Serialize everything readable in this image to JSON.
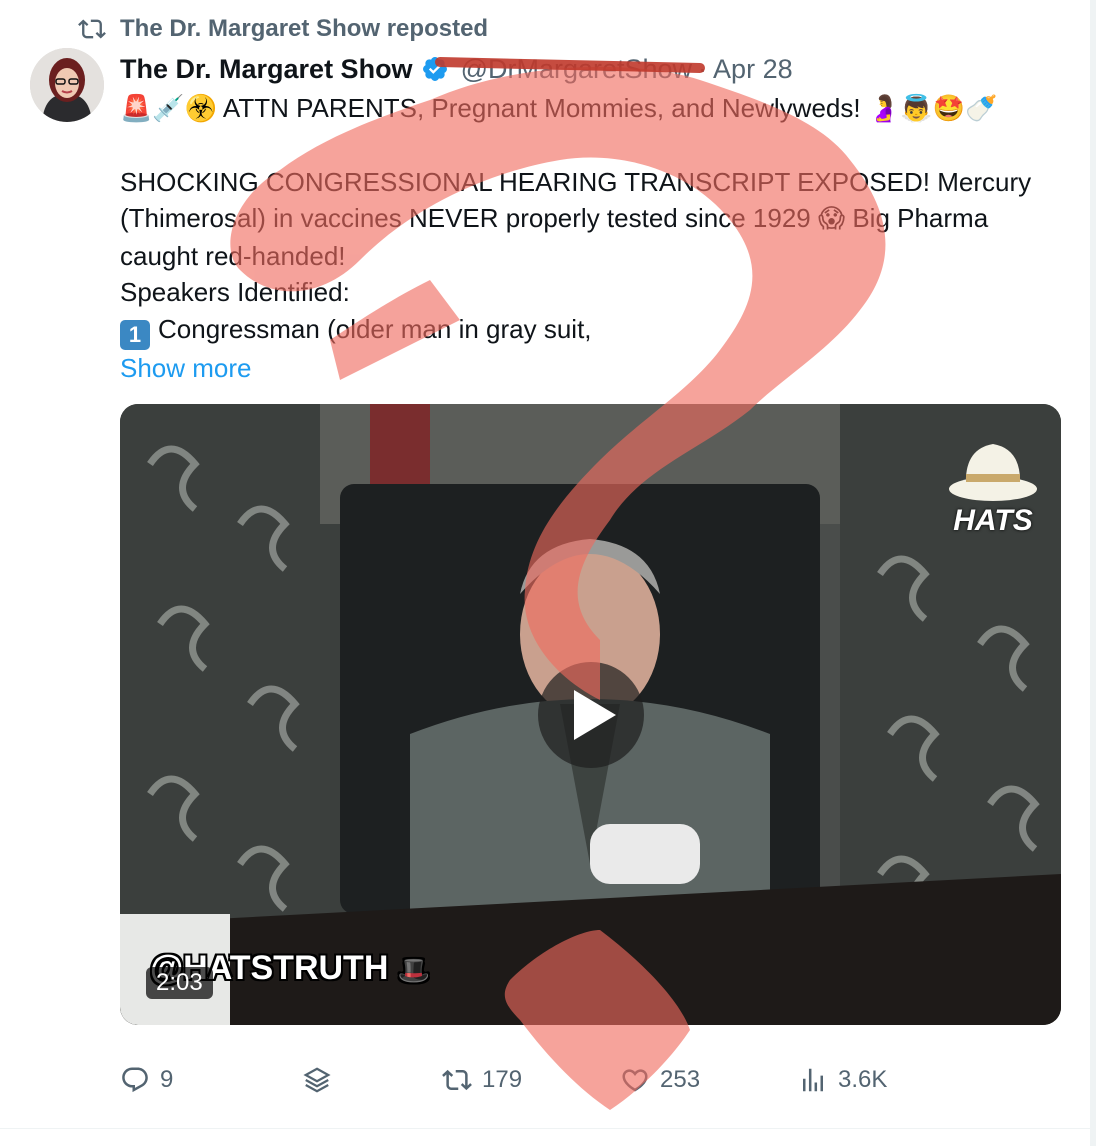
{
  "repost": {
    "text": "The Dr. Margaret Show reposted",
    "icon": "repost-icon"
  },
  "author": {
    "name": "The Dr. Margaret Show",
    "handle": "@DrMargaretShow",
    "date": "Apr 28",
    "separator": "·",
    "verified": true
  },
  "post": {
    "line1_emoji_prefix": "🚨💉☣️",
    "line1_text": "ATTN PARENTS, Pregnant Mommies, and Newlyweds!",
    "line1_emoji_suffix": "🤰👼🤩🍼",
    "para2_a": "SHOCKING CONGRESSIONAL HEARING TRANSCRIPT EXPOSED! Mercury (Thimerosal) in vaccines NEVER properly tested since 1929",
    "para2_emoji": "😱",
    "para2_b": "Big Pharma caught red-handed!",
    "line_speakers": "Speakers Identified:",
    "keycap": "1",
    "line_congressman": "Congressman (older man in gray suit,",
    "show_more": "Show more"
  },
  "media": {
    "duration": "2:03",
    "watermark": "@HATSTRUTH",
    "watermark_emoji": "🎩",
    "logo_text": "HATS"
  },
  "actions": {
    "replies": "9",
    "reposts": "179",
    "likes": "253",
    "views": "3.6K"
  },
  "colors": {
    "accent": "#1d9bf0",
    "muted": "#536471",
    "overlay_mark": "#f06a5e"
  }
}
